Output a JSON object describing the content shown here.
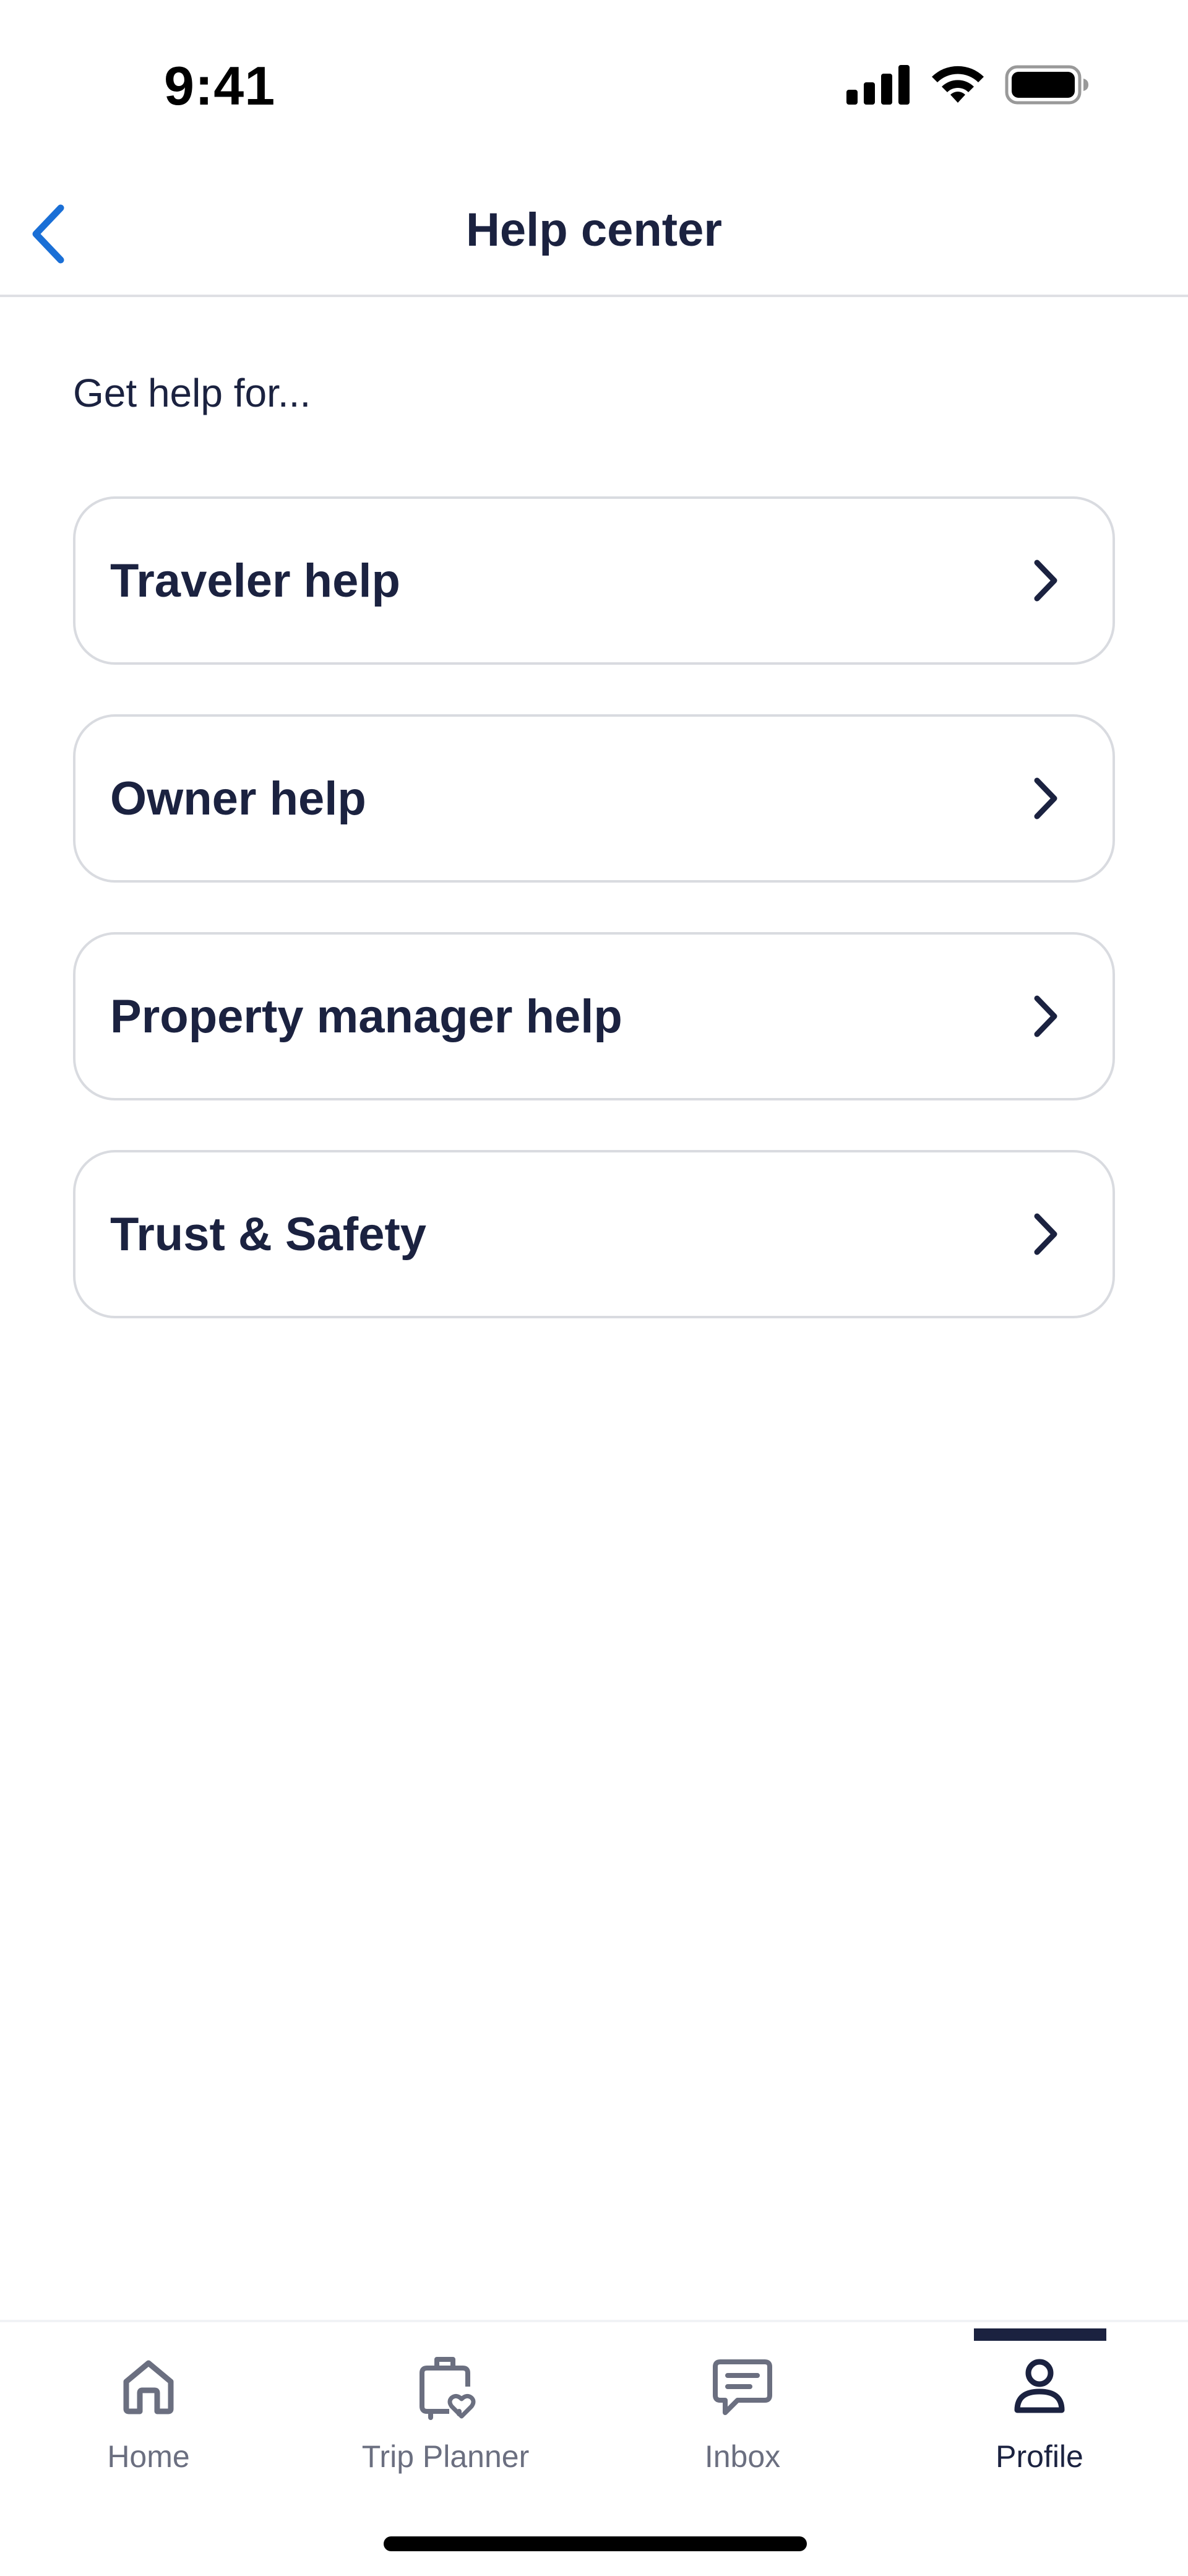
{
  "status_bar": {
    "time": "9:41",
    "icons": [
      "cellular-signal-icon",
      "wifi-icon",
      "battery-icon"
    ]
  },
  "header": {
    "title": "Help center",
    "back_icon": "chevron-left-icon"
  },
  "content": {
    "section_label": "Get help for...",
    "items": [
      {
        "label": "Traveler help",
        "icon": "chevron-right-icon"
      },
      {
        "label": "Owner help",
        "icon": "chevron-right-icon"
      },
      {
        "label": "Property manager help",
        "icon": "chevron-right-icon"
      },
      {
        "label": "Trust & Safety",
        "icon": "chevron-right-icon"
      }
    ]
  },
  "tab_bar": {
    "tabs": [
      {
        "label": "Home",
        "icon": "home-icon",
        "active": false
      },
      {
        "label": "Trip Planner",
        "icon": "suitcase-heart-icon",
        "active": false
      },
      {
        "label": "Inbox",
        "icon": "message-icon",
        "active": false
      },
      {
        "label": "Profile",
        "icon": "person-icon",
        "active": true
      }
    ]
  },
  "colors": {
    "text_primary": "#1b2240",
    "text_secondary": "#6b6f80",
    "accent_blue": "#1a6fd6",
    "card_border": "#d9dbe0"
  }
}
